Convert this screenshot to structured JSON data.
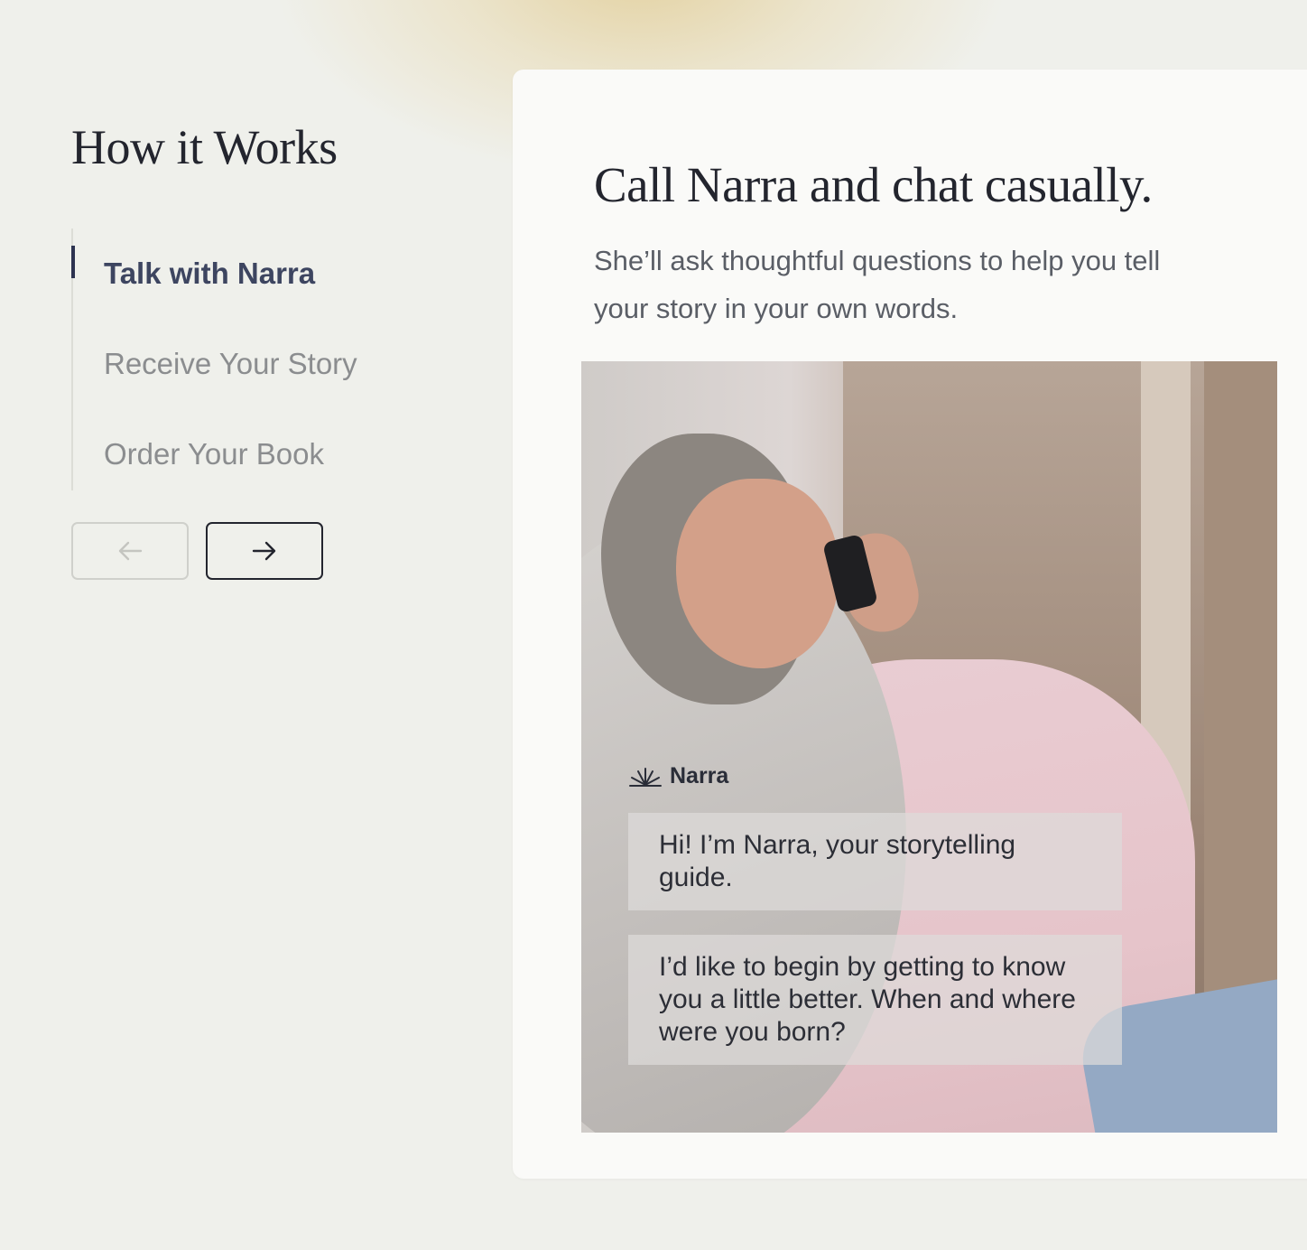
{
  "section": {
    "title": "How it Works"
  },
  "steps": [
    {
      "label": "Talk with Narra",
      "active": true
    },
    {
      "label": "Receive Your Story",
      "active": false
    },
    {
      "label": "Order Your Book",
      "active": false
    }
  ],
  "nav": {
    "prev_icon": "arrow-left-icon",
    "next_icon": "arrow-right-icon"
  },
  "card": {
    "title": "Call Narra and chat casually.",
    "description": "She’ll ask thoughtful questions to help you tell your story in your own words."
  },
  "chat": {
    "brand": "Narra",
    "brand_icon": "narra-lotus-icon",
    "messages": [
      "Hi! I’m Narra, your storytelling guide.",
      "I’d like to begin by getting to know you a little better. When and where were you born?"
    ]
  },
  "colors": {
    "active": "#3d4560",
    "inactive": "#8b8d8f",
    "text_dark": "#23252e",
    "background": "#eff0eb"
  }
}
